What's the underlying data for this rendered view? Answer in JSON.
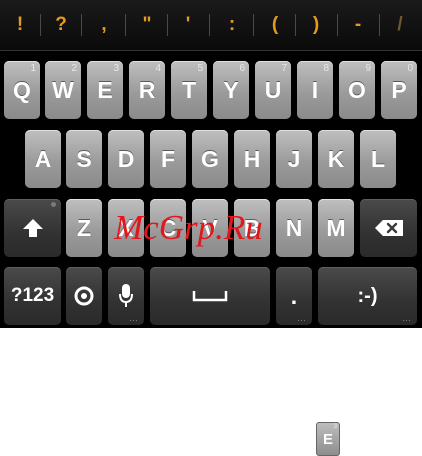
{
  "suggestions": [
    "!",
    "?",
    ",",
    "\"",
    "'",
    ":",
    "(",
    ")",
    "-",
    "/"
  ],
  "row1": [
    {
      "label": "Q",
      "hint": "1"
    },
    {
      "label": "W",
      "hint": "2"
    },
    {
      "label": "E",
      "hint": "3"
    },
    {
      "label": "R",
      "hint": "4"
    },
    {
      "label": "T",
      "hint": "5"
    },
    {
      "label": "Y",
      "hint": "6"
    },
    {
      "label": "U",
      "hint": "7"
    },
    {
      "label": "I",
      "hint": "8"
    },
    {
      "label": "O",
      "hint": "9"
    },
    {
      "label": "P",
      "hint": "0"
    }
  ],
  "row2": [
    "A",
    "S",
    "D",
    "F",
    "G",
    "H",
    "J",
    "K",
    "L"
  ],
  "row3": [
    "Z",
    "X",
    "C",
    "V",
    "B",
    "N",
    "M"
  ],
  "bottom": {
    "symbols_label": "?123",
    "period_label": ".",
    "smiley_label": ":-)"
  },
  "watermark": "McGrp.Ru",
  "preview": {
    "label": "E",
    "hint": "3"
  },
  "colors": {
    "suggestion": "#e39b1f",
    "watermark": "#e2171d"
  },
  "icons": {
    "shift": "shift-arrow-icon",
    "delete": "backspace-icon",
    "settings": "settings-icon",
    "voice": "microphone-icon",
    "space": "space-bar-icon"
  }
}
